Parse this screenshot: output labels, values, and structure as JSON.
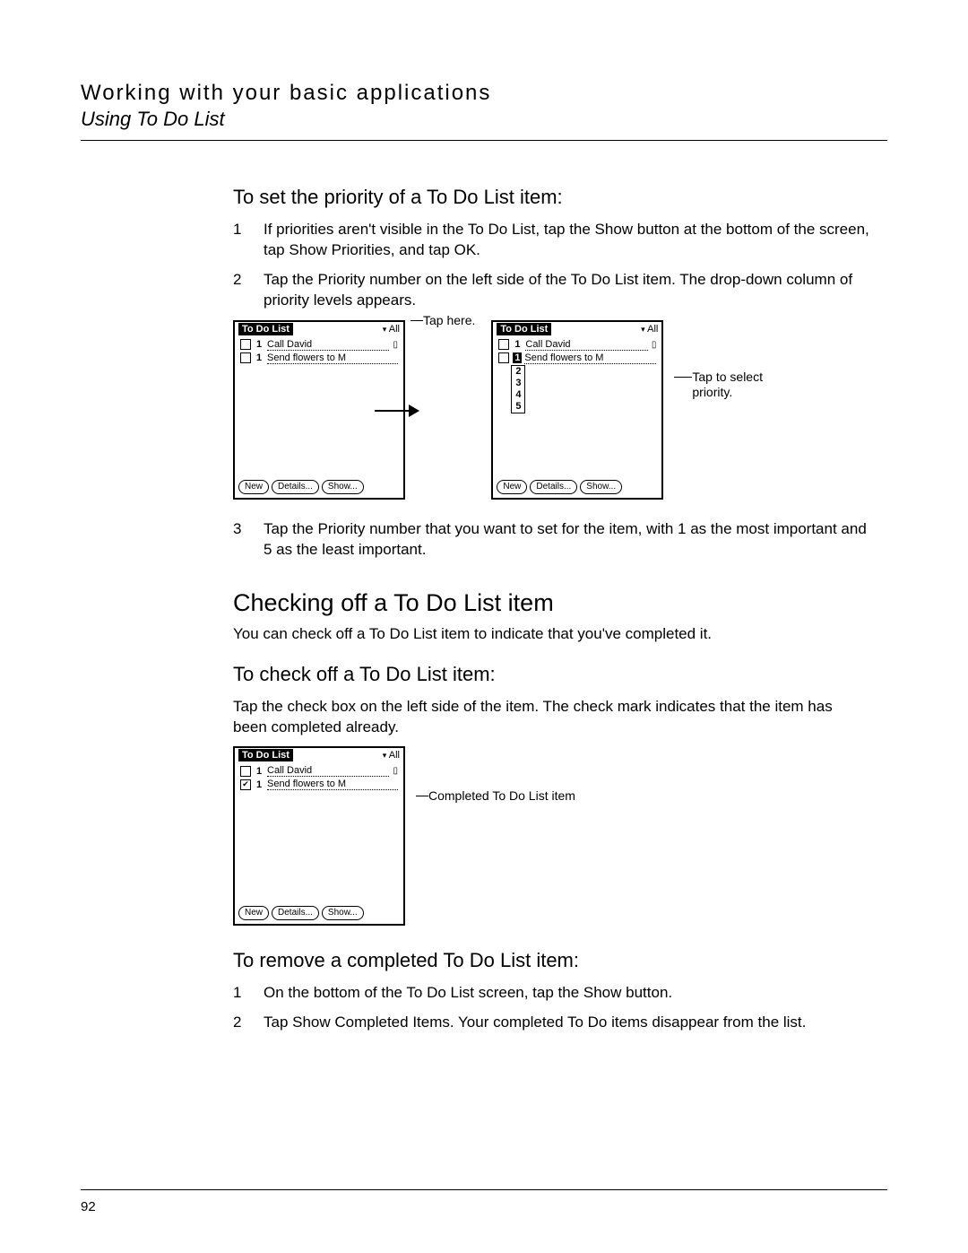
{
  "header": {
    "title": "Working with your basic applications",
    "subtitle": "Using To Do List"
  },
  "sections": {
    "setPriority": {
      "heading": "To set the priority of a To Do List item:",
      "steps": [
        "If priorities aren't visible in the To Do List, tap the Show button at the bottom of the screen, tap Show Priorities, and tap OK.",
        "Tap the Priority number on the left side of the To Do List item. The drop-down column of priority levels appears.",
        "Tap the Priority number that you want to set for the item, with 1 as the most important and 5 as the least important."
      ],
      "callouts": {
        "tapHere": "Tap here.",
        "tapToSelect": "Tap to select priority."
      }
    },
    "checkingOff": {
      "heading": "Checking off a To Do List item",
      "intro": "You can check off a To Do List item to indicate that you've completed it.",
      "subheading": "To check off a To Do List item:",
      "body": "Tap the check box on the left side of the item. The check mark indicates that the item has been completed already.",
      "callout": "Completed To Do List item"
    },
    "removeCompleted": {
      "heading": "To remove a completed To Do List item:",
      "steps": [
        "On the bottom of the To Do List screen, tap the Show button.",
        "Tap Show Completed Items. Your completed To Do items disappear from the list."
      ]
    }
  },
  "pda": {
    "title": "To Do List",
    "category": "All",
    "items": [
      {
        "priority": "1",
        "text": "Call David",
        "checked": false,
        "note": true
      },
      {
        "priority": "1",
        "text": "Send flowers to M",
        "checked": false,
        "note": false
      }
    ],
    "itemsChecked": [
      {
        "priority": "1",
        "text": "Call David",
        "checked": false,
        "note": true
      },
      {
        "priority": "1",
        "text": "Send flowers to M",
        "checked": true,
        "note": false
      }
    ],
    "priorityLevels": [
      "1",
      "2",
      "3",
      "4",
      "5"
    ],
    "buttons": {
      "new": "New",
      "details": "Details...",
      "show": "Show..."
    }
  },
  "pageNumber": "92"
}
